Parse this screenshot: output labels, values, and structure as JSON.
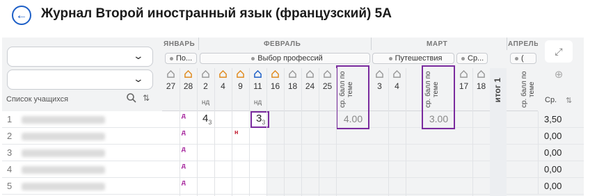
{
  "header": {
    "back_icon": "arrow-left-icon",
    "title": "Журнал Второй иностранный язык (французский) 5А"
  },
  "filters": {
    "select1_value": "",
    "select2_value": "",
    "students_label": "Список учащихся",
    "search_icon": "search-icon",
    "sort_icon": "sort-icon"
  },
  "months": [
    "ЯНВАРЬ",
    "ФЕВРАЛЬ",
    "МАРТ",
    "АПРЕЛЬ"
  ],
  "topics": [
    "По...",
    "Выбор профессий",
    "Путешествия",
    "Ср...",
    "("
  ],
  "dates": [
    "27",
    "28",
    "2",
    "4",
    "9",
    "11",
    "16",
    "18",
    "24",
    "25",
    "3",
    "4",
    "17",
    "18"
  ],
  "lesson_types": {
    "nd": "нд"
  },
  "avg_column_label": "ср. балл по теме",
  "avg_short_label": "ср. балл по теме",
  "itog_label": "итог 1",
  "topic_averages": [
    "4.00",
    "3.00"
  ],
  "students": [
    {
      "num": "1"
    },
    {
      "num": "2"
    },
    {
      "num": "3"
    },
    {
      "num": "4"
    },
    {
      "num": "5"
    }
  ],
  "marks": {
    "d": "д",
    "n": "н",
    "grade1": "4",
    "grade1_sub": "3",
    "grade2": "3",
    "grade2_sub": "3"
  },
  "right_panel": {
    "expand_icon": "expand-icon",
    "zoom_icon": "zoom-in-icon",
    "avg_header": "Ср.",
    "avg_sort": "⇅",
    "averages": [
      "3,50",
      "0,00",
      "0,00",
      "0,00",
      "0,00"
    ]
  },
  "colors": {
    "accent": "#1d5fc7",
    "highlight": "#7a2b9e",
    "mark_d": "#a31f9a",
    "mark_n": "#c0192e"
  }
}
